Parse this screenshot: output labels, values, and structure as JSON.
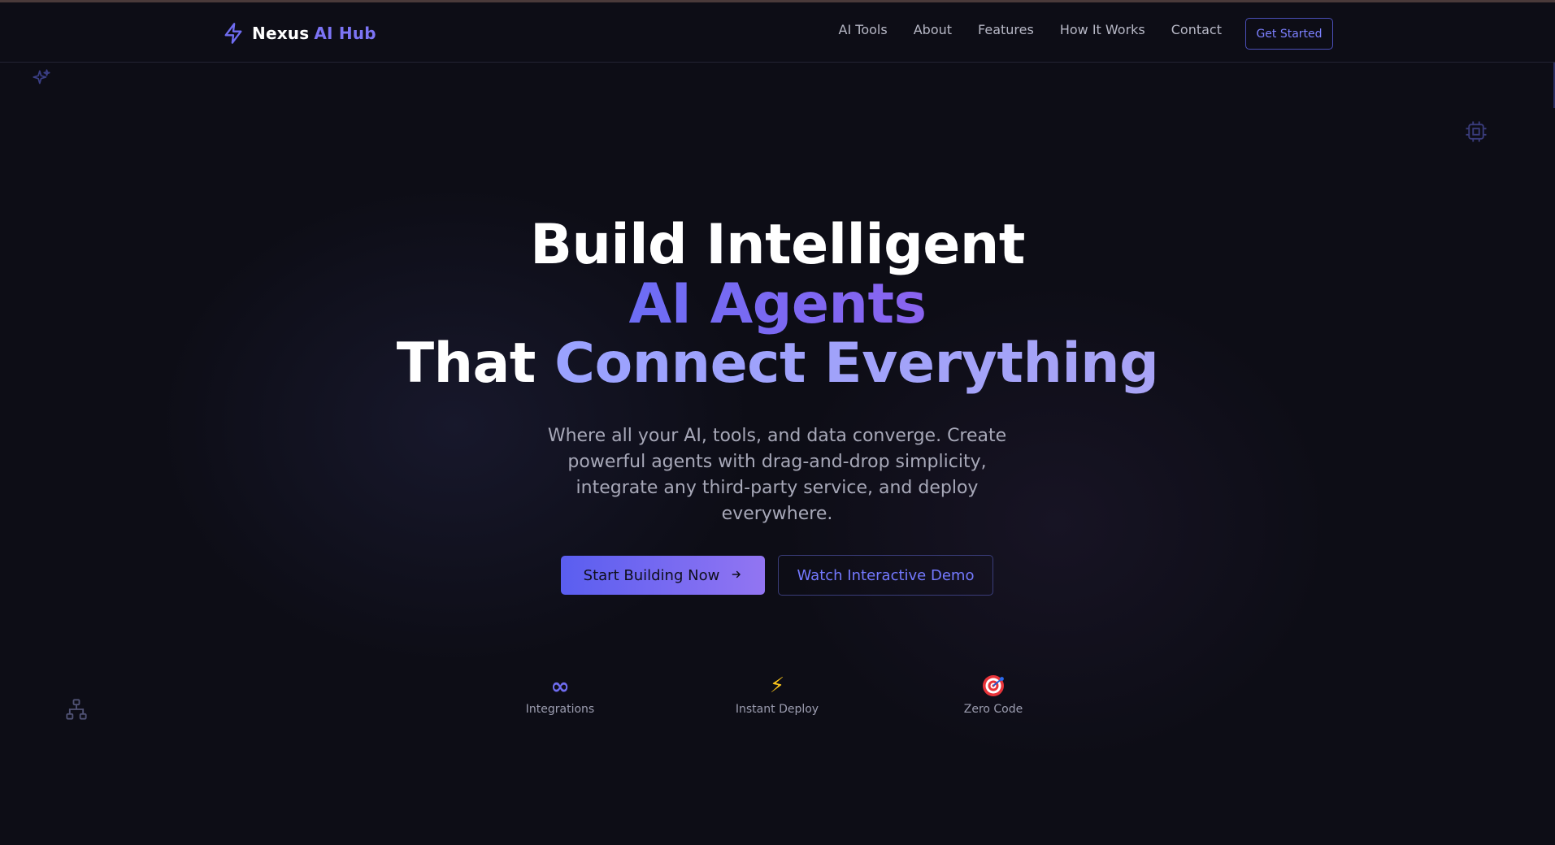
{
  "brand": {
    "name": "Nexus",
    "accent": "AI Hub",
    "icon": "lightning-bolt-icon",
    "accent_color": "#7c74f5"
  },
  "nav": {
    "links": [
      {
        "label": "AI Tools"
      },
      {
        "label": "About"
      },
      {
        "label": "Features"
      },
      {
        "label": "How It Works"
      },
      {
        "label": "Contact"
      }
    ],
    "cta_label": "Get Started"
  },
  "hero": {
    "title_line1": "Build Intelligent",
    "title_line2": "AI Agents",
    "title_line3_plain": "That ",
    "title_line3_accent": "Connect Everything",
    "subtitle": "Where all your AI, tools, and data converge. Create powerful agents with drag-and-drop simplicity, integrate any third-party service, and deploy everywhere.",
    "primary_button": "Start Building Now",
    "primary_button_icon": "arrow-right-icon",
    "secondary_button": "Watch Interactive Demo"
  },
  "stats": [
    {
      "icon": "infinity-icon",
      "glyph": "∞",
      "label": "Integrations"
    },
    {
      "icon": "lightning-icon",
      "glyph": "⚡",
      "label": "Instant Deploy"
    },
    {
      "icon": "target-icon",
      "glyph": "🎯",
      "label": "Zero Code"
    }
  ],
  "decorations": [
    "sparkles-icon",
    "cpu-chip-icon",
    "network-icon"
  ],
  "colors": {
    "background": "#0d0d16",
    "primary": "#5a5ef0",
    "primary_end": "#9275f2",
    "text_muted": "#a7a8b8"
  }
}
